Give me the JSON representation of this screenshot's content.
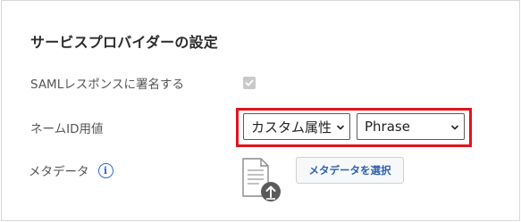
{
  "section": {
    "title": "サービスプロバイダーの設定"
  },
  "saml_response": {
    "label": "SAMLレスポンスに署名する",
    "checked": true
  },
  "name_id": {
    "label": "ネームID用値",
    "type_select_value": "カスタム属性",
    "format_select_value": "Phrase"
  },
  "metadata": {
    "label": "メタデータ",
    "info_glyph": "i",
    "select_button_label": "メタデータを選択"
  },
  "colors": {
    "highlight": "#e0141e",
    "accent": "#2f6bd8"
  },
  "icons": {
    "info": "info-icon",
    "file": "file-upload-icon",
    "checkbox": "checkmark-icon",
    "chevron": "chevron-down-icon"
  }
}
